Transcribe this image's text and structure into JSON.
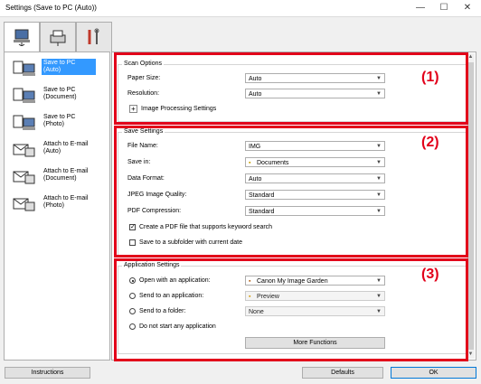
{
  "window": {
    "title": "Settings (Save to PC (Auto))",
    "min": "—",
    "max": "☐",
    "close": "✕"
  },
  "tabs": [
    "scan-from-computer",
    "scan-from-operation-panel",
    "general-settings"
  ],
  "sidebar": {
    "items": [
      {
        "label": "Save to PC (Auto)",
        "selected": true
      },
      {
        "label": "Save to PC (Document)"
      },
      {
        "label": "Save to PC (Photo)"
      },
      {
        "label": "Attach to E-mail (Auto)"
      },
      {
        "label": "Attach to E-mail (Document)"
      },
      {
        "label": "Attach to E-mail (Photo)"
      }
    ]
  },
  "scan_options": {
    "title": "Scan Options",
    "paper_size_label": "Paper Size:",
    "paper_size": "Auto",
    "resolution_label": "Resolution:",
    "resolution": "Auto",
    "image_processing_label": "Image Processing Settings",
    "plus": "+"
  },
  "save_settings": {
    "title": "Save Settings",
    "file_name_label": "File Name:",
    "file_name": "IMG",
    "save_in_label": "Save in:",
    "save_in": "Documents",
    "data_format_label": "Data Format:",
    "data_format": "Auto",
    "jpeg_quality_label": "JPEG Image Quality:",
    "jpeg_quality": "Standard",
    "pdf_compression_label": "PDF Compression:",
    "pdf_compression": "Standard",
    "keyword_pdf_label": "Create a PDF file that supports keyword search",
    "keyword_pdf_checked": "✓",
    "subfolder_label": "Save to a subfolder with current date"
  },
  "app_settings": {
    "title": "Application Settings",
    "open_app_label": "Open with an application:",
    "open_app": "Canon My Image Garden",
    "send_app_label": "Send to an application:",
    "send_app": "Preview",
    "send_folder_label": "Send to a folder:",
    "send_folder": "None",
    "no_app_label": "Do not start any application",
    "more_functions": "More Functions"
  },
  "annotations": {
    "n1": "(1)",
    "n2": "(2)",
    "n3": "(3)",
    "color": "#e2001a"
  },
  "footer": {
    "instructions": "Instructions",
    "defaults": "Defaults",
    "ok": "OK"
  }
}
